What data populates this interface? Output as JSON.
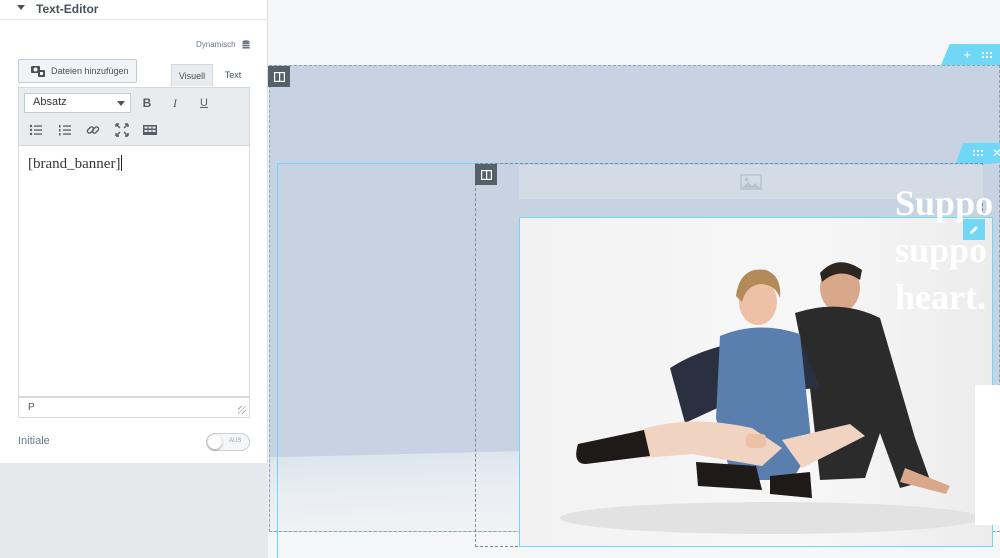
{
  "panel": {
    "section_title": "Text-Editor",
    "dynamic_label": "Dynamisch",
    "add_files_label": "Dateien hinzufügen",
    "tabs": [
      {
        "label": "Visuell",
        "active": true
      },
      {
        "label": "Text",
        "active": false
      }
    ],
    "format_select": "Absatz",
    "toolbar_icons": [
      "bold-icon",
      "italic-icon",
      "underline-icon",
      "bullet-list-icon",
      "numbered-list-icon",
      "link-icon",
      "fullscreen-icon",
      "toolbar-toggle-icon"
    ],
    "editor_content": "[brand_banner]",
    "status_path": "P",
    "initiale_label": "Initiale",
    "initiale_toggle": "AUS"
  },
  "canvas": {
    "heading_lines": [
      "Suppo",
      "suppo",
      "heart."
    ],
    "accent_color": "#71d7f7",
    "section_color": "#c7d3e2"
  }
}
